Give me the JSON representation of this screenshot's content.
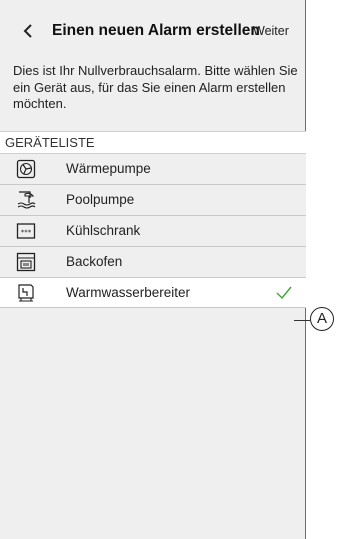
{
  "header": {
    "back_icon": "chevron-left-icon",
    "title": "Einen neuen Alarm erstellen",
    "next_label": "Weiter"
  },
  "description": "Dies ist Ihr Nullverbrauchsalarm. Bitte wählen Sie ein Gerät aus, für das Sie einen Alarm erstellen möchten.",
  "device_list": {
    "header": "GERÄTELISTE",
    "items": [
      {
        "label": "Wärmepumpe",
        "icon": "heat-pump-icon",
        "selected": false
      },
      {
        "label": "Poolpumpe",
        "icon": "pool-pump-icon",
        "selected": false
      },
      {
        "label": "Kühlschrank",
        "icon": "fridge-icon",
        "selected": false
      },
      {
        "label": "Backofen",
        "icon": "oven-icon",
        "selected": false
      },
      {
        "label": "Warmwasserbereiter",
        "icon": "water-heater-icon",
        "selected": true
      }
    ]
  },
  "callout": {
    "letter": "A"
  },
  "colors": {
    "check": "#3fa535",
    "background": "#efefef",
    "selected_row": "#ffffff"
  }
}
